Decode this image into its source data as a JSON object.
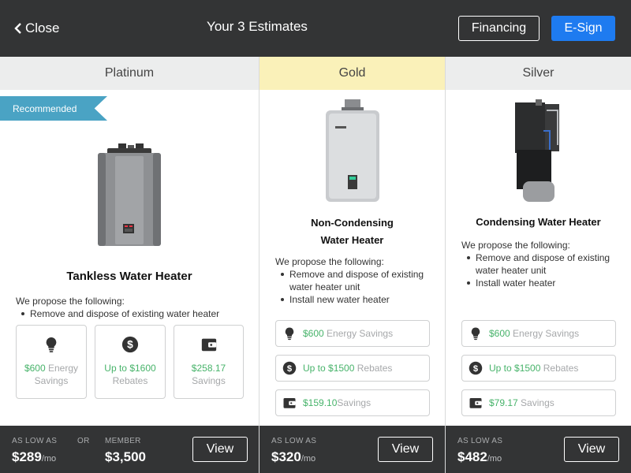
{
  "header": {
    "close_label": "Close",
    "title": "Your 3 Estimates",
    "financing_label": "Financing",
    "esign_label": "E-Sign"
  },
  "colors": {
    "accent_blue": "#1e7bf0",
    "ribbon": "#4aa3c4",
    "gold_header": "#faf1b9",
    "savings_green": "#47b36a",
    "dark_bar": "#333435"
  },
  "estimates": [
    {
      "tier": "Platinum",
      "ribbon": "Recommended",
      "product": "Tankless Water Heater",
      "propose_title": "We propose the following:",
      "items": [
        "Remove and dispose of existing water heater"
      ],
      "benefits": [
        {
          "icon": "lightbulb-icon",
          "value": "$600",
          "label": "Energy Savings"
        },
        {
          "icon": "dollar-icon",
          "value": "Up to $1600",
          "label": "Rebates"
        },
        {
          "icon": "wallet-icon",
          "value": "$258.17",
          "label": "Savings"
        }
      ],
      "footer": {
        "low_label": "AS LOW AS",
        "low_value": "$289",
        "per": "/mo",
        "or_label": "OR",
        "member_label": "MEMBER",
        "member_value": "$3,500",
        "view_label": "View"
      }
    },
    {
      "tier": "Gold",
      "product_line1": "Non-Condensing",
      "product_line2": "Water Heater",
      "propose_title": "We propose the following:",
      "items": [
        "Remove and dispose of existing water heater unit",
        "Install new water heater"
      ],
      "benefits": [
        {
          "icon": "lightbulb-icon",
          "value": "$600",
          "label": "Energy Savings"
        },
        {
          "icon": "dollar-icon",
          "value": "Up to $1500",
          "label": "Rebates"
        },
        {
          "icon": "wallet-icon",
          "value": "$159.10",
          "label": "Savings"
        }
      ],
      "footer": {
        "low_label": "AS LOW AS",
        "low_value": "$320",
        "per": "/mo",
        "view_label": "View"
      }
    },
    {
      "tier": "Silver",
      "product": "Condensing Water Heater",
      "propose_title": "We propose the following:",
      "items": [
        "Remove and dispose of existing water heater unit",
        "Install water heater"
      ],
      "benefits": [
        {
          "icon": "lightbulb-icon",
          "value": "$600",
          "label": "Energy Savings"
        },
        {
          "icon": "dollar-icon",
          "value": "Up to $1500",
          "label": "Rebates"
        },
        {
          "icon": "wallet-icon",
          "value": "$79.17",
          "label": "Savings"
        }
      ],
      "footer": {
        "low_label": "AS LOW AS",
        "low_value": "$482",
        "per": "/mo",
        "view_label": "View"
      }
    }
  ]
}
